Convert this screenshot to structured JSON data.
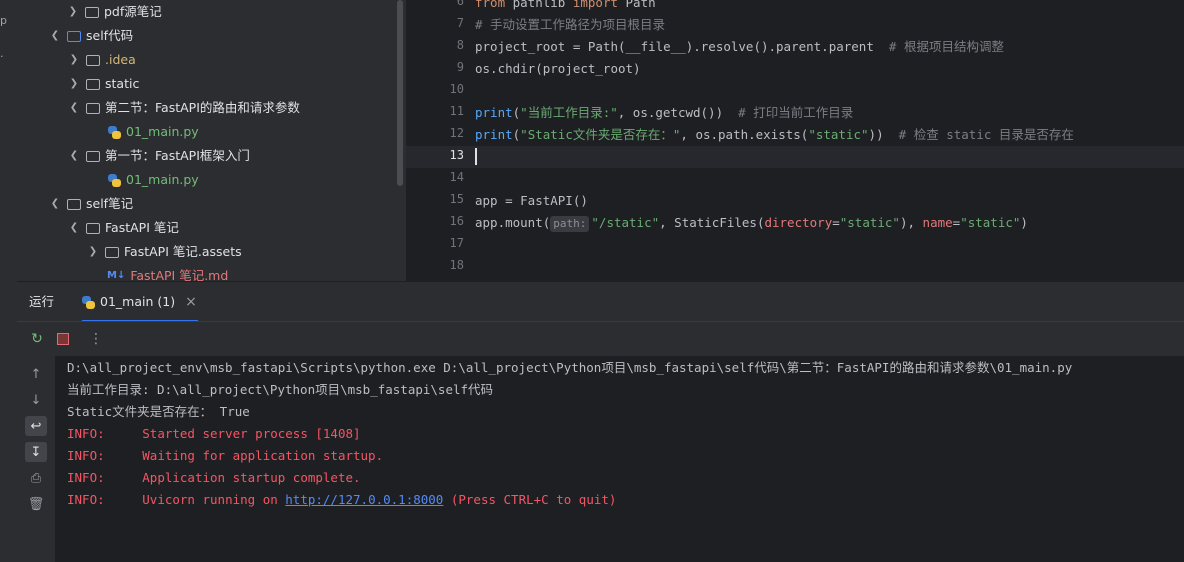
{
  "tree": {
    "items": [
      {
        "label": "pdf源笔记",
        "state": "collapsed",
        "type": "folder"
      },
      {
        "label": "self代码",
        "state": "expanded",
        "type": "folder-blue"
      },
      {
        "label": ".idea",
        "state": "collapsed",
        "type": "folder"
      },
      {
        "label": "static",
        "state": "collapsed",
        "type": "folder"
      },
      {
        "label": "第二节：FastAPI的路由和请求参数",
        "state": "expanded",
        "type": "folder"
      },
      {
        "label": "01_main.py",
        "type": "python-file"
      },
      {
        "label": "第一节：FastAPI框架入门",
        "state": "expanded",
        "type": "folder"
      },
      {
        "label": "01_main.py",
        "type": "python-file"
      },
      {
        "label": "self笔记",
        "state": "expanded",
        "type": "folder"
      },
      {
        "label": "FastAPI 笔记",
        "state": "expanded",
        "type": "folder"
      },
      {
        "label": "FastAPI 笔记.assets",
        "state": "collapsed",
        "type": "folder"
      },
      {
        "label": "FastAPI 笔记.md",
        "type": "markdown-file"
      }
    ]
  },
  "editor": {
    "line_numbers": [
      "6",
      "7",
      "8",
      "9",
      "10",
      "11",
      "12",
      "13",
      "14",
      "15",
      "16",
      "17",
      "18"
    ],
    "current_line": "13",
    "lines": {
      "l6": {
        "kw1": "from",
        "mod": " pathlib ",
        "kw2": "import",
        "name": " Path"
      },
      "l7": {
        "comment": "# 手动设置工作路径为项目根目录"
      },
      "l8": {
        "code": "project_root = Path(__file__).resolve().parent.parent  ",
        "comment": "# 根据项目结构调整"
      },
      "l9": {
        "code": "os.chdir(project_root)"
      },
      "l11": {
        "fn": "print",
        "open": "(",
        "str": "\"当前工作目录:\"",
        "rest": ", os.getcwd())  ",
        "comment": "# 打印当前工作目录"
      },
      "l12": {
        "fn": "print",
        "open": "(",
        "str": "\"Static文件夹是否存在：\"",
        "rest1": ", os.path.exists(",
        "str2": "\"static\"",
        "rest2": "))  ",
        "comment": "# 检查 static 目录是否存在"
      },
      "l15": {
        "code": "app = FastAPI()"
      },
      "l16": {
        "a": "app.mount(",
        "hint": "path:",
        "s1": "\"/static\"",
        "b": ", StaticFiles(",
        "p1": "directory",
        "eq1": "=",
        "s2": "\"static\"",
        "c": "), ",
        "p2": "name",
        "eq2": "=",
        "s3": "\"static\"",
        "d": ")"
      }
    }
  },
  "run_panel": {
    "title": "运行",
    "tab_label": "01_main (1)",
    "close_glyph": "×"
  },
  "console": {
    "lines": [
      "D:\\all_project_env\\msb_fastapi\\Scripts\\python.exe D:\\all_project\\Python项目\\msb_fastapi\\self代码\\第二节：FastAPI的路由和请求参数\\01_main.py",
      "当前工作目录: D:\\all_project\\Python项目\\msb_fastapi\\self代码",
      "Static文件夹是否存在： True"
    ],
    "info": [
      {
        "level": "INFO:",
        "msg": "Started server process [1408]"
      },
      {
        "level": "INFO:",
        "msg": "Waiting for application startup."
      },
      {
        "level": "INFO:",
        "msg": "Application startup complete."
      }
    ],
    "last": {
      "level": "INFO:",
      "pre": "Uvicorn running on ",
      "url": "http://127.0.0.1:8000",
      "post": " (Press CTRL+C to quit)"
    }
  },
  "colors": {
    "accent": "#3574f0",
    "error": "#f75464",
    "string": "#6aab73",
    "keyword": "#cf8e6d"
  }
}
